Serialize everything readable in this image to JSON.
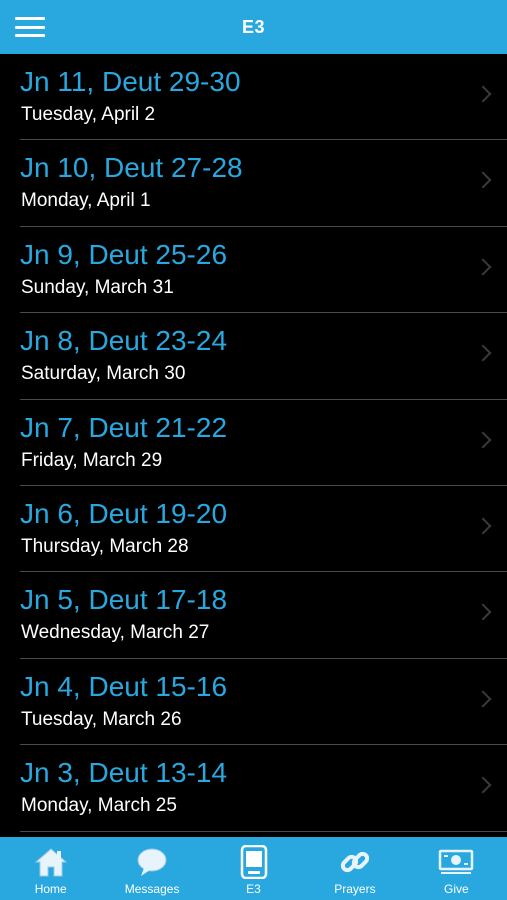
{
  "header": {
    "title": "E3"
  },
  "readings": [
    {
      "title": "Jn 11, Deut 29-30",
      "date": "Tuesday, April 2"
    },
    {
      "title": "Jn 10, Deut 27-28",
      "date": "Monday, April 1"
    },
    {
      "title": "Jn 9, Deut 25-26",
      "date": "Sunday, March 31"
    },
    {
      "title": "Jn 8, Deut 23-24",
      "date": "Saturday, March 30"
    },
    {
      "title": "Jn 7, Deut 21-22",
      "date": "Friday, March 29"
    },
    {
      "title": "Jn 6, Deut 19-20",
      "date": "Thursday, March 28"
    },
    {
      "title": "Jn 5, Deut 17-18",
      "date": "Wednesday, March 27"
    },
    {
      "title": "Jn 4, Deut 15-16",
      "date": "Tuesday, March 26"
    },
    {
      "title": "Jn 3, Deut 13-14",
      "date": "Monday, March 25"
    }
  ],
  "tabs": [
    {
      "label": "Home",
      "icon": "home-icon"
    },
    {
      "label": "Messages",
      "icon": "chat-bubble-icon"
    },
    {
      "label": "E3",
      "icon": "e3-app-icon",
      "active": true
    },
    {
      "label": "Prayers",
      "icon": "chain-link-icon"
    },
    {
      "label": "Give",
      "icon": "money-icon"
    }
  ],
  "colors": {
    "accent": "#29a8e0",
    "background": "#000000",
    "divider": "#4a4a4a"
  }
}
